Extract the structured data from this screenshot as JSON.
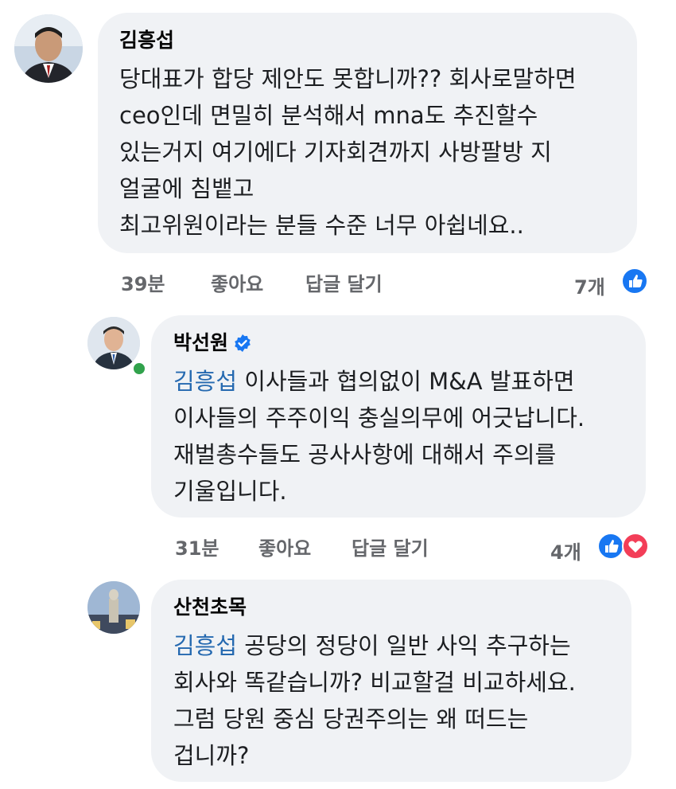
{
  "comments": [
    {
      "author": "김흥섭",
      "lines": [
        "당대표가 합당 제안도 못합니까?? 회사로말하면",
        "ceo인데 면밀히 분석해서 mna도 추진할수",
        "있는거지  여기에다 기자회견까지 사방팔방 지",
        "얼굴에 침뱉고",
        "최고위원이라는 분들 수준 너무 아쉽네요.."
      ],
      "time": "39분",
      "like_label": "좋아요",
      "reply_label": "답글 달기",
      "reaction_count": "7개",
      "reactions": [
        "like-icon"
      ]
    },
    {
      "author": "박선원",
      "verified": true,
      "online": true,
      "mention": "김흥섭",
      "first_line_rest": " 이사들과 협의없이 M&A 발표하면",
      "lines": [
        "이사들의 주주이익 충실의무에 어긋납니다.",
        "재벌총수들도 공사사항에 대해서 주의를",
        "기울입니다."
      ],
      "time": "31분",
      "like_label": "좋아요",
      "reply_label": "답글 달기",
      "reaction_count": "4개",
      "reactions": [
        "like-icon",
        "love-icon"
      ]
    },
    {
      "author": "산천초목",
      "mention": "김흥섭",
      "first_line_rest": " 공당의 정당이 일반 사익 추구하는",
      "lines": [
        "회사와 똑같습니까? 비교할걸 비교하세요.",
        "그럼 당원 중심 당권주의는 왜 떠드는",
        "겁니까?"
      ]
    }
  ],
  "colors": {
    "bubble": "#f0f2f5",
    "mention": "#2569b0",
    "meta": "#65676b",
    "like": "#1877f2",
    "love": "#f33e58",
    "online": "#31a24c"
  }
}
